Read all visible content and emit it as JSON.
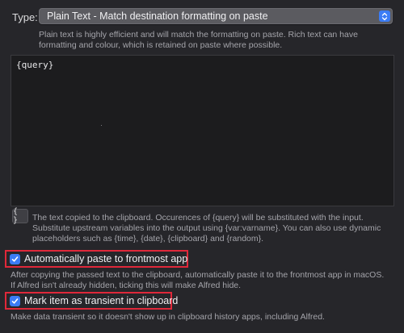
{
  "type": {
    "label": "Type:",
    "selected": "Plain Text - Match destination formatting on paste",
    "help": "Plain text is highly efficient and will match the formatting on paste. Rich text can have formatting and colour, which is retained on paste where possible."
  },
  "editor": {
    "value": "{query}",
    "placeholder_button": "{ }",
    "help": "The text copied to the clipboard. Occurences of {query} will be substituted with the input. Substitute upstream variables into the output using {var:varname}. You can also use dynamic placeholders such as {time}, {date}, {clipboard} and {random}."
  },
  "options": {
    "auto_paste": {
      "label": "Automatically paste to frontmost app",
      "checked": true,
      "help": "After copying the passed text to the clipboard, automatically paste it to the frontmost app in macOS. If Alfred isn't already hidden, ticking this will make Alfred hide."
    },
    "transient": {
      "label": "Mark item as transient in clipboard",
      "checked": true,
      "help": "Make data transient so it doesn't show up in clipboard history apps, including Alfred."
    }
  },
  "colors": {
    "background": "#26262a",
    "accent": "#3b7cf5",
    "highlight_frame": "#e0283a"
  },
  "icons": {
    "select_stepper": "chevron-up-down-icon",
    "checkbox": "checkmark-icon"
  }
}
